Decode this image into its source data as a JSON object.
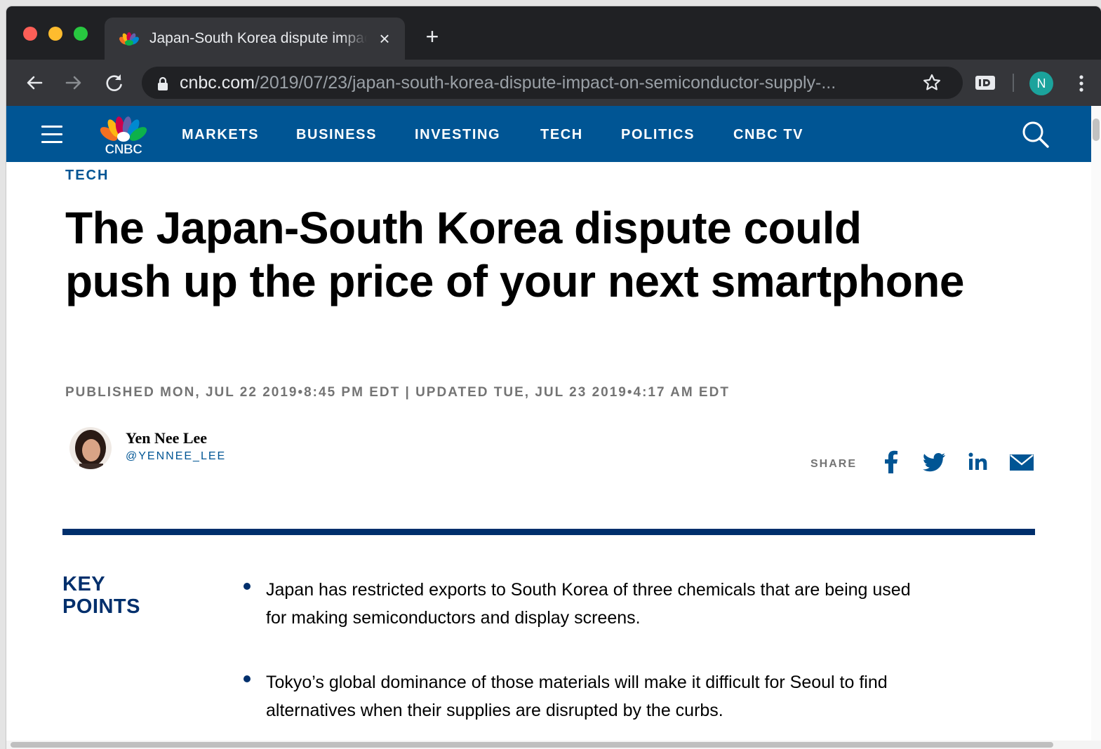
{
  "browser": {
    "tab": {
      "title": "Japan-South Korea dispute impact on semiconductor supply",
      "favicon": "nbc-peacock-icon"
    },
    "new_tab_symbol": "+",
    "close_symbol": "×",
    "address": {
      "host": "cnbc.com",
      "path": "/2019/07/23/japan-south-korea-dispute-impact-on-semiconductor-supply-..."
    },
    "profile_initial": "N",
    "icons": {
      "back": "arrow-left-icon",
      "forward": "arrow-right-icon",
      "reload": "reload-icon",
      "secure": "lock-icon",
      "bookmark": "star-icon",
      "extension": "id-extension-icon",
      "menu": "kebab-menu-icon"
    }
  },
  "site": {
    "brand": "CNBC",
    "brand_color": "#005594",
    "nav": [
      {
        "label": "MARKETS"
      },
      {
        "label": "BUSINESS"
      },
      {
        "label": "INVESTING"
      },
      {
        "label": "TECH"
      },
      {
        "label": "POLITICS"
      },
      {
        "label": "CNBC TV"
      }
    ]
  },
  "article": {
    "section": "TECH",
    "headline": "The Japan-South Korea dispute could push up the price of your next smartphone",
    "dateline": "PUBLISHED MON, JUL 22 2019•8:45 PM EDT | UPDATED TUE, JUL 23 2019•4:17 AM EDT",
    "author": {
      "name": "Yen Nee Lee",
      "handle": "@YENNEE_LEE"
    },
    "share_label": "SHARE",
    "share_icons": [
      "facebook-icon",
      "twitter-icon",
      "linkedin-icon",
      "email-icon"
    ],
    "key_points_title_line1": "KEY",
    "key_points_title_line2": "POINTS",
    "key_points": [
      "Japan has restricted exports to South Korea of three chemicals that are being used for making semiconductors and display screens.",
      "Tokyo’s global dominance of those materials will make it difficult for Seoul to find alternatives when their supplies are disrupted by the curbs."
    ]
  }
}
